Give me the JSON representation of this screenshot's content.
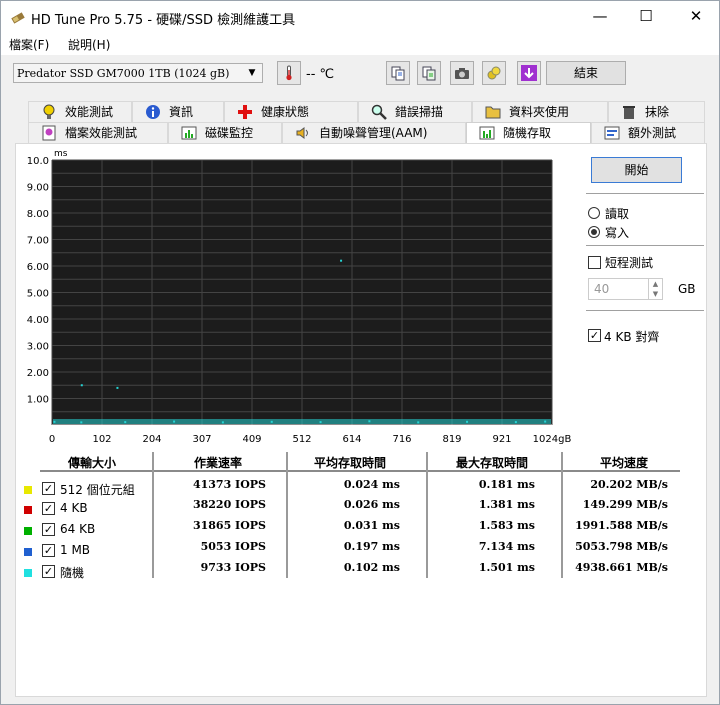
{
  "window": {
    "title": "HD Tune Pro 5.75 - 硬碟/SSD 檢測維護工具",
    "minimize": "—",
    "maximize": "☐",
    "close": "✕"
  },
  "menu": {
    "file": "檔案(F)",
    "help": "說明(H)"
  },
  "toolbar": {
    "drive": "Predator SSD GM7000 1TB (1024 gB)",
    "temperature": "-- ℃",
    "exit_label": "結束"
  },
  "tabs_top": [
    {
      "label": "效能測試",
      "icon": "bulb-icon"
    },
    {
      "label": "資訊",
      "icon": "info-icon"
    },
    {
      "label": "健康狀態",
      "icon": "health-cross-icon"
    },
    {
      "label": "錯誤掃描",
      "icon": "magnifier-icon"
    },
    {
      "label": "資料夾使用",
      "icon": "folder-icon"
    },
    {
      "label": "抹除",
      "icon": "trash-icon"
    }
  ],
  "tabs_bottom": [
    {
      "label": "檔案效能測試",
      "icon": "file-bulb-icon"
    },
    {
      "label": "磁碟監控",
      "icon": "monitor-chart-icon"
    },
    {
      "label": "自動噪聲管理(AAM)",
      "icon": "speaker-icon"
    },
    {
      "label": "隨機存取",
      "icon": "random-access-icon"
    },
    {
      "label": "額外測試",
      "icon": "extra-test-icon"
    }
  ],
  "controls": {
    "start_label": "開始",
    "read_label": "讀取",
    "write_label": "寫入",
    "short_test_label": "短程測試",
    "short_test_value": "40",
    "gb_unit": "GB",
    "align_label": "4 KB 對齊",
    "mode_selected": "write",
    "short_test_checked": false,
    "align_checked": true
  },
  "chart_data": {
    "type": "scatter",
    "y_unit": "ms",
    "ylim": [
      0,
      10
    ],
    "y_ticks": [
      "10.0",
      "9.00",
      "8.00",
      "7.00",
      "6.00",
      "5.00",
      "4.00",
      "3.00",
      "2.00",
      "1.00"
    ],
    "x_ticks": [
      "0",
      "102",
      "204",
      "307",
      "409",
      "512",
      "614",
      "716",
      "819",
      "921",
      "1024gB"
    ],
    "xlim": [
      0,
      1024
    ],
    "grid": true,
    "background": "#1c1c1c",
    "series": [
      {
        "name": "隨機",
        "color": "#26d4d4",
        "points": [
          [
            5,
            0.12
          ],
          [
            60,
            0.1
          ],
          [
            150,
            0.11
          ],
          [
            250,
            0.13
          ],
          [
            350,
            0.1
          ],
          [
            450,
            0.12
          ],
          [
            550,
            0.11
          ],
          [
            650,
            0.14
          ],
          [
            750,
            0.1
          ],
          [
            850,
            0.12
          ],
          [
            950,
            0.11
          ],
          [
            1010,
            0.13
          ],
          [
            61,
            1.5
          ],
          [
            134,
            1.4
          ],
          [
            592,
            6.2
          ]
        ]
      }
    ]
  },
  "results": {
    "headers": [
      "傳輸大小",
      "作業速率",
      "平均存取時間",
      "最大存取時間",
      "平均速度"
    ],
    "rows": [
      {
        "label": "512 個位元組",
        "color": "#e8e800",
        "iops": "41373 IOPS",
        "avg": "0.024 ms",
        "max": "0.181 ms",
        "speed": "20.202 MB/s"
      },
      {
        "label": "4 KB",
        "color": "#d00000",
        "iops": "38220 IOPS",
        "avg": "0.026 ms",
        "max": "1.381 ms",
        "speed": "149.299 MB/s"
      },
      {
        "label": "64 KB",
        "color": "#00b000",
        "iops": "31865 IOPS",
        "avg": "0.031 ms",
        "max": "1.583 ms",
        "speed": "1991.588 MB/s"
      },
      {
        "label": "1 MB",
        "color": "#2060d0",
        "iops": "5053 IOPS",
        "avg": "0.197 ms",
        "max": "7.134 ms",
        "speed": "5053.798 MB/s"
      },
      {
        "label": "隨機",
        "color": "#20e0e0",
        "iops": "9733 IOPS",
        "avg": "0.102 ms",
        "max": "1.501 ms",
        "speed": "4938.661 MB/s"
      }
    ]
  }
}
